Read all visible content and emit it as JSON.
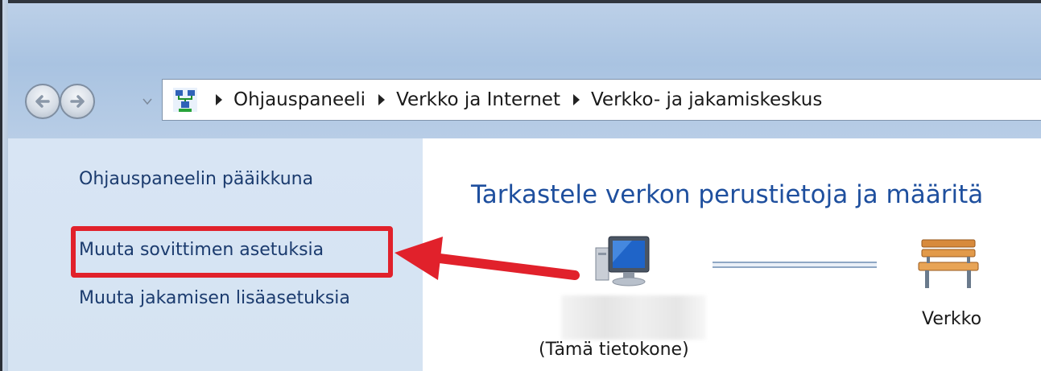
{
  "address_bar": {
    "crumbs": [
      "Ohjauspaneeli",
      "Verkko ja Internet",
      "Verkko- ja jakamiskeskus"
    ]
  },
  "left_pane": {
    "items": [
      {
        "label": "Ohjauspaneelin pääikkuna"
      },
      {
        "label": "Muuta sovittimen asetuksia"
      },
      {
        "label": "Muuta jakamisen lisäasetuksia"
      }
    ]
  },
  "main": {
    "title": "Tarkastele verkon perustietoja ja määritä",
    "computer_label": "(Tämä tietokone)",
    "network_label": "Verkko"
  },
  "colors": {
    "highlight": "#e1212b",
    "link": "#1b3b6e",
    "title": "#1e4f9e"
  },
  "icons": {
    "back": "back-arrow-icon",
    "forward": "forward-arrow-icon",
    "address": "network-center-icon",
    "computer": "computer-icon",
    "network": "bench-icon"
  }
}
